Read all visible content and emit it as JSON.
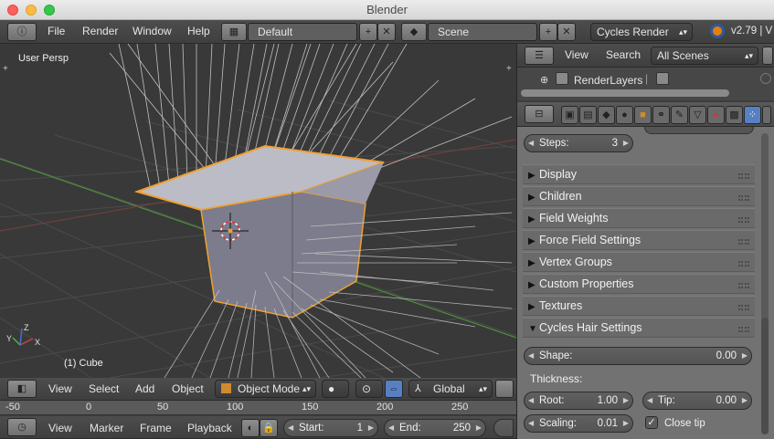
{
  "window": {
    "title": "Blender"
  },
  "topbar": {
    "menus": [
      "File",
      "Render",
      "Window",
      "Help"
    ],
    "screen": "Default",
    "scene": "Scene",
    "engine": "Cycles Render",
    "version": "v2.79 | V"
  },
  "outliner": {
    "view": "View",
    "search": "Search",
    "filter": "All Scenes",
    "item": "RenderLayers"
  },
  "viewport": {
    "label": "User Persp",
    "object": "(1) Cube",
    "axis_labels": {
      "x": "X",
      "y": "Y",
      "z": "Z"
    }
  },
  "viewport_header": {
    "menus": [
      "View",
      "Select",
      "Add",
      "Object"
    ],
    "mode": "Object Mode",
    "orientation": "Global"
  },
  "properties": {
    "steps_label": "Steps:",
    "steps_value": "3",
    "panels": [
      "Display",
      "Children",
      "Field Weights",
      "Force Field Settings",
      "Vertex Groups",
      "Custom Properties",
      "Textures"
    ],
    "cycles_hair": {
      "title": "Cycles Hair Settings",
      "shape_label": "Shape:",
      "shape_value": "0.00",
      "thickness_label": "Thickness:",
      "root_label": "Root:",
      "root_value": "1.00",
      "tip_label": "Tip:",
      "tip_value": "0.00",
      "scaling_label": "Scaling:",
      "scaling_value": "0.01",
      "close_tip_label": "Close tip",
      "close_tip_checked": true
    }
  },
  "timeline_ruler": {
    "ticks": [
      "-50",
      "0",
      "50",
      "100",
      "150",
      "200",
      "250"
    ]
  },
  "timeline_header": {
    "menus": [
      "View",
      "Marker",
      "Frame",
      "Playback"
    ],
    "start_label": "Start:",
    "start_value": "1",
    "end_label": "End:",
    "end_value": "250"
  },
  "icons": {
    "info": "info-icon",
    "screen": "screen-layout-icon",
    "scene": "scene-icon",
    "add": "plus-icon",
    "close": "x-icon",
    "blender": "blender-logo-icon",
    "outliner": "outliner-editor-icon",
    "properties": "properties-editor-icon",
    "timeline": "timeline-clock-icon"
  },
  "colors": {
    "selection_outline": "#f0a030",
    "grid": "#4a4a4a",
    "x_axis": "#c04545",
    "y_axis": "#5aa540",
    "active_tab": "#5680c2"
  }
}
